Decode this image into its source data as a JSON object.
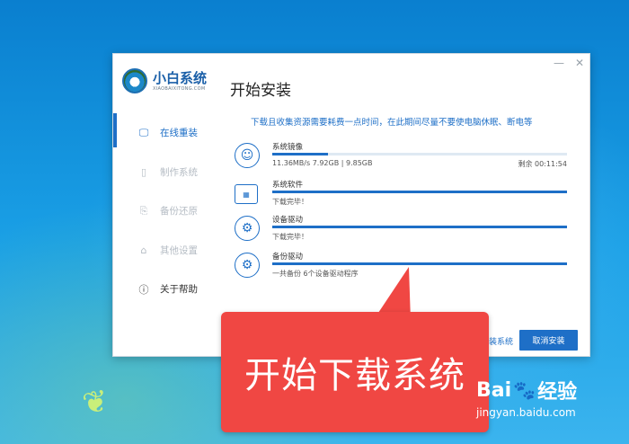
{
  "app": {
    "logo_title": "小白系统",
    "logo_sub": "XIAOBAIXITONG.COM",
    "page_title": "开始安装",
    "controls": {
      "minimize": "—",
      "close": "✕"
    }
  },
  "sidebar": {
    "items": [
      {
        "label": "在线重装",
        "icon": "🖵",
        "active": true
      },
      {
        "label": "制作系统",
        "icon": "▯",
        "active": false
      },
      {
        "label": "备份还原",
        "icon": "⎘",
        "active": false
      },
      {
        "label": "其他设置",
        "icon": "⌂",
        "active": false
      },
      {
        "label": "关于帮助",
        "icon": "ⓘ",
        "active": false
      }
    ]
  },
  "notice": "下载且收集资源需要耗费一点时间，在此期间尽量不要使电脑休眠、断电等",
  "tasks": [
    {
      "name": "系统镜像",
      "status": "11.36MB/s 7.92GB | 9.85GB",
      "remain": "剩余 00:11:54",
      "progress": 0.19,
      "icon": "smiley-icon",
      "glyph": "☺"
    },
    {
      "name": "系统软件",
      "status": "下载完毕！",
      "progress": 1.0,
      "icon": "folder-icon",
      "glyph": "▦"
    },
    {
      "name": "设备驱动",
      "status": "下载完毕！",
      "progress": 1.0,
      "icon": "gear-icon",
      "glyph": "⚙"
    },
    {
      "name": "备份驱动",
      "status": "一共备份 6个设备驱动程序",
      "progress": 1.0,
      "icon": "gear-icon",
      "glyph": "⚙"
    }
  ],
  "buttons": {
    "cancel": "取消安装",
    "secondary_link": "装系统"
  },
  "callout": {
    "text": "开始下载系统"
  },
  "watermark": {
    "brand": "Bai",
    "brand2": "经验",
    "url": "jingyan.baidu.com"
  },
  "desktop": {
    "leaf_icon": "❦"
  },
  "colors": {
    "accent": "#1e6fc7",
    "callout": "#f04743"
  }
}
